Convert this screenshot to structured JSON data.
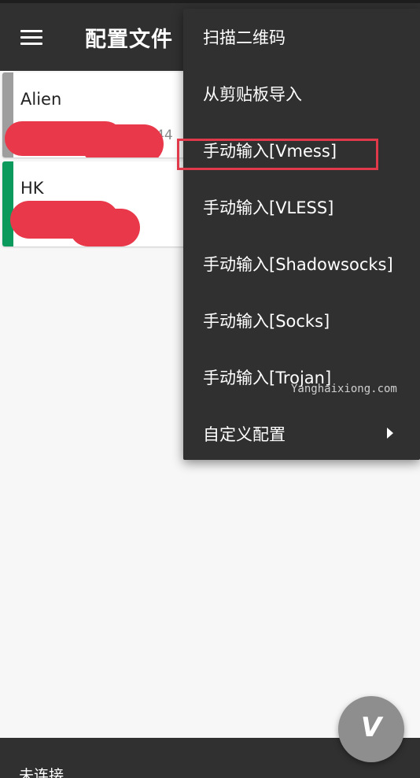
{
  "toolbar": {
    "title": "配置文件",
    "menu_icon": "hamburger-menu-icon"
  },
  "servers": [
    {
      "name": "Alien",
      "address_fragment": "44",
      "accent_color": "#9e9e9e"
    },
    {
      "name": "HK",
      "address_fragment": "",
      "accent_color": "#0b9a5b"
    }
  ],
  "menu": {
    "items": [
      {
        "label": "扫描二维码"
      },
      {
        "label": "从剪贴板导入"
      },
      {
        "label": "手动输入[Vmess]"
      },
      {
        "label": "手动输入[VLESS]"
      },
      {
        "label": "手动输入[Shadowsocks]"
      },
      {
        "label": "手动输入[Socks]"
      },
      {
        "label": "手动输入[Trojan]"
      },
      {
        "label": "自定义配置",
        "has_submenu": true,
        "submenu_icon": "chevron-right-icon"
      }
    ],
    "highlighted_item": "手动输入[Vmess]"
  },
  "watermark": "Yanghaixiong.com",
  "fab": {
    "glyph": "V",
    "icon": "v-logo-icon"
  },
  "status": {
    "text": "未连接"
  },
  "colors": {
    "toolbar": "#303030",
    "menu_background": "#303030",
    "highlight_border": "#e03a4a",
    "redaction": "#e8384a",
    "fab": "#8e8e8e"
  }
}
